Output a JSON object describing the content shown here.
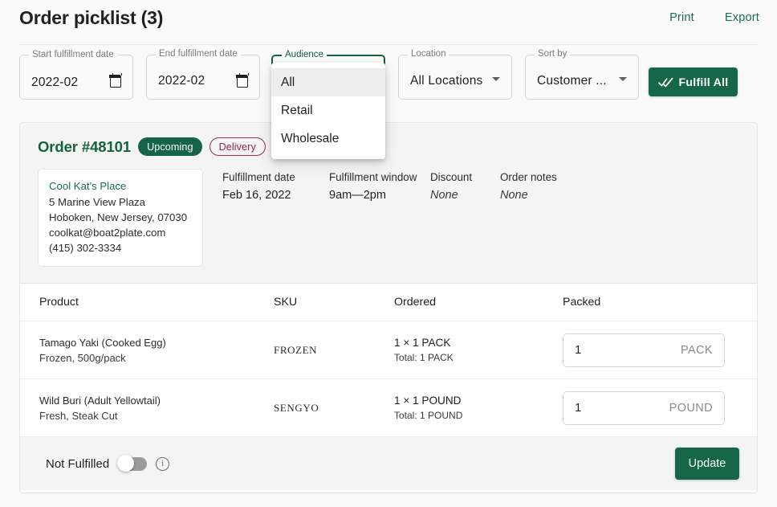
{
  "header": {
    "title": "Order picklist (3)",
    "print_label": "Print",
    "export_label": "Export"
  },
  "filters": {
    "start_date": {
      "label": "Start fulfillment date",
      "value": "2022-02",
      "icon": "calendar-icon"
    },
    "end_date": {
      "label": "End fulfillment date",
      "value": "2022-02",
      "icon": "calendar-icon"
    },
    "audience": {
      "label": "Audience",
      "value": "All",
      "options": [
        "All",
        "Retail",
        "Wholesale"
      ],
      "selected": "All"
    },
    "location": {
      "label": "Location",
      "value": "All Locations",
      "icon": "chevron-down-icon"
    },
    "sort_by": {
      "label": "Sort by",
      "value": "Customer ...",
      "icon": "chevron-down-icon"
    },
    "fulfill_all_label": "Fulfill All",
    "fulfill_all_icon": "done-all-icon"
  },
  "order": {
    "title": "Order #48101",
    "status_chip": "Upcoming",
    "type_chip": "Delivery",
    "customer": {
      "name": "Cool Kat's Place",
      "street": "5 Marine View Plaza",
      "city_state_zip": "Hoboken, New Jersey, 07030",
      "email": "coolkat@boat2plate.com",
      "phone": "(415) 302-3334"
    },
    "facts": [
      {
        "label": "Fulfillment date",
        "value": "Feb 16, 2022",
        "italic": false
      },
      {
        "label": "Fulfillment window",
        "value": "9am—2pm",
        "italic": false
      },
      {
        "label": "Discount",
        "value": "None",
        "italic": true
      },
      {
        "label": "Order notes",
        "value": "None",
        "italic": true
      }
    ]
  },
  "table": {
    "columns": [
      "Product",
      "SKU",
      "Ordered",
      "Packed"
    ],
    "rows": [
      {
        "product": "Tamago Yaki (Cooked Egg)",
        "variant": "Frozen, 500g/pack",
        "sku": "FROZEN",
        "ordered": "1 × 1 PACK",
        "ordered_total": "Total: 1 PACK",
        "packed_qty": "1",
        "packed_unit": "PACK"
      },
      {
        "product": "Wild Buri (Adult Yellowtail)",
        "variant": "Fresh, Steak Cut",
        "sku": "SENGYO",
        "ordered": "1 × 1 POUND",
        "ordered_total": "Total: 1 POUND",
        "packed_qty": "1",
        "packed_unit": "POUND"
      }
    ]
  },
  "footer": {
    "toggle_label": "Not Fulfilled",
    "toggle_state": "off",
    "info_icon": "info-icon",
    "update_label": "Update"
  },
  "colors": {
    "brand_green": "#16674a",
    "link_green": "#1b6b4d",
    "chip_outline": "#9e2a5a",
    "page_bg": "#fafafa",
    "panel_bg": "#f4f4f4"
  }
}
